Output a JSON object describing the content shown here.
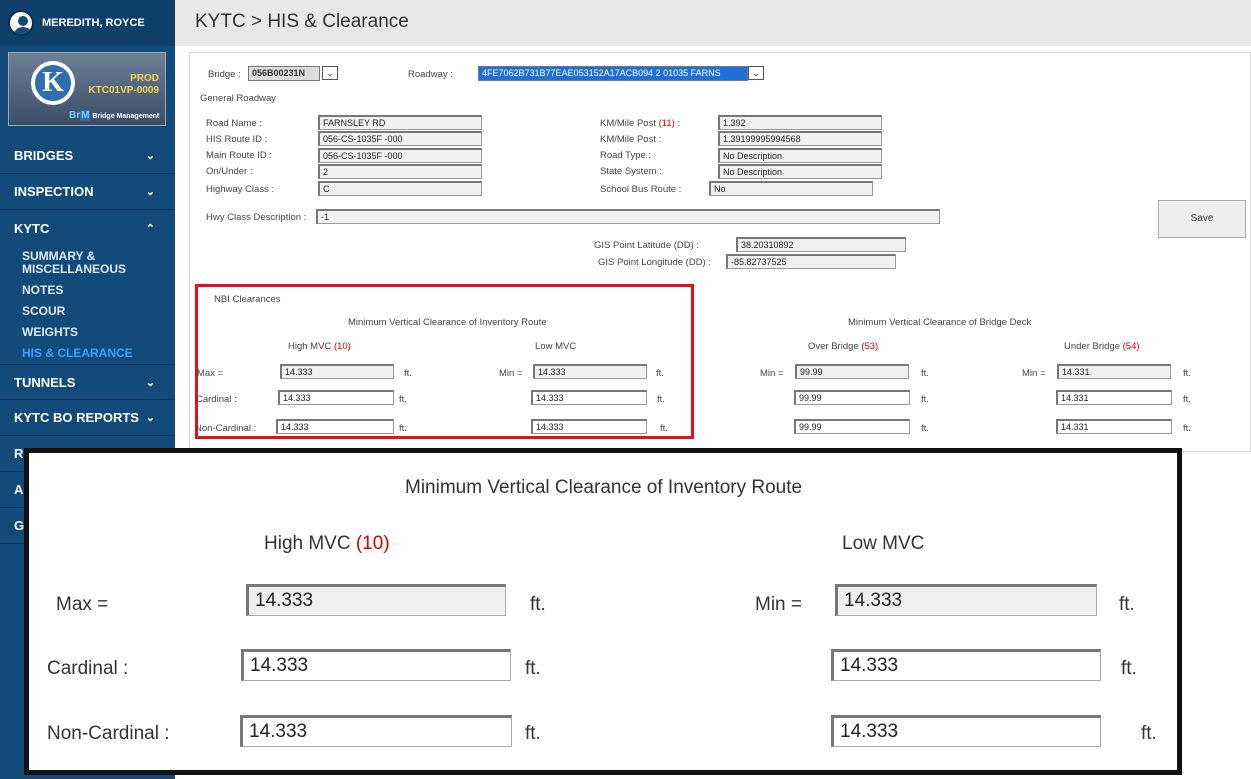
{
  "user": {
    "name": "MEREDITH, ROYCE"
  },
  "logo": {
    "k": "K",
    "env": "PROD",
    "server": "KTC01VP-0009",
    "brm": "Br",
    "brm2": "M",
    "product": "Bridge Management"
  },
  "nav": {
    "bridges": "BRIDGES",
    "inspection": "INSPECTION",
    "kytc": "KYTC",
    "subs": [
      "SUMMARY & MISCELLANEOUS",
      "NOTES",
      "SCOUR",
      "WEIGHTS",
      "HIS & CLEARANCE"
    ],
    "tunnels": "TUNNELS",
    "bo_reports": "KYTC BO REPORTS",
    "r": "R",
    "a": "A",
    "g": "G",
    "chev_down": "⌄",
    "chev_up": "⌃"
  },
  "page": {
    "title": "KYTC > HIS & Clearance"
  },
  "form": {
    "bridge_label": "Bridge :",
    "bridge_value": "056B00231N",
    "roadway_label": "Roadway :",
    "roadway_value": "4FE7062B731B77EAE053152A17ACB094 2 01035 FARNS",
    "general_roadway": "General Roadway",
    "road_name_label": "Road Name :",
    "road_name": "FARNSLEY RD",
    "his_route_label": "HIS Route ID :",
    "his_route": "056-CS-1035F -000",
    "main_route_label": "Main Route ID :",
    "main_route": "056-CS-1035F -000",
    "on_under_label": "On/Under :",
    "on_under": "2",
    "highway_class_label": "Highway Class :",
    "highway_class": "C",
    "km_post_label": "KM/Mile Post",
    "km_post_num": "(11)",
    "km_post_colon": ":",
    "km_post": "1.392",
    "km_post2_label": "KM/Mile Post :",
    "km_post2": "1.39199995994568",
    "road_type_label": "Road Type :",
    "road_type": "No Description",
    "state_system_label": "State System :",
    "state_system": "No Description",
    "school_bus_label": "School Bus Route :",
    "school_bus": "No",
    "hwy_desc_label": "Hwy Class Description :",
    "hwy_desc": "-1",
    "save": "Save",
    "lat_label": "GIS Point Latitude (DD) :",
    "lat": "38.20310892",
    "lon_label": "GIS Point Longitude (DD) :",
    "lon": "-85.82737525"
  },
  "nbi": {
    "title": "NBI Clearances",
    "inv_heading": "Minimum Vertical Clearance of Inventory Route",
    "deck_heading": "Minimum Vertical Clearance of Bridge Deck",
    "high_mvc": "High MVC",
    "high_num": "(10)",
    "low_mvc": "Low MVC",
    "over_bridge": "Over Bridge",
    "over_num": "(53)",
    "under_bridge": "Under Bridge",
    "under_num": "(54)",
    "max_label": "Max =",
    "min_label": "Min =",
    "cardinal_label": "Cardinal :",
    "noncardinal_label": "Non-Cardinal :",
    "unit": "ft.",
    "high_max": "14.333",
    "high_cardinal": "14.333",
    "high_noncardinal": "14.333",
    "low_min": "14.333",
    "low_cardinal": "14.333",
    "low_noncardinal": "14.333",
    "over_min": "99.99",
    "over_cardinal": "99.99",
    "over_noncardinal": "99.99",
    "under_min": "14.331",
    "under_cardinal": "14.331",
    "under_noncardinal": "14.331"
  }
}
